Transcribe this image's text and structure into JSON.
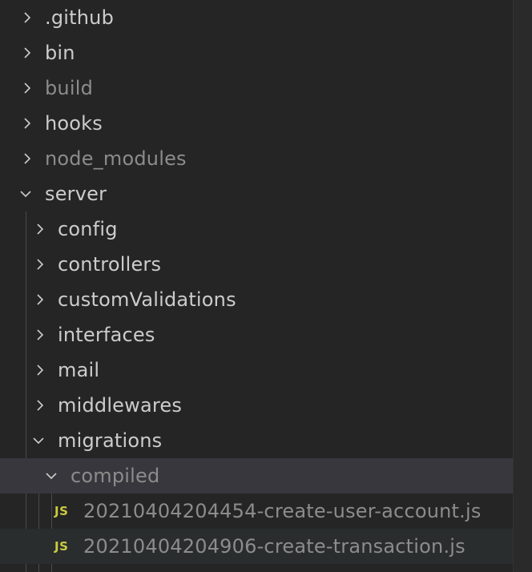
{
  "tree": {
    "root_items": [
      {
        "label": ".github",
        "icon": "chevron-right-icon"
      },
      {
        "label": "bin",
        "icon": "chevron-right-icon"
      },
      {
        "label": "build",
        "icon": "chevron-right-icon"
      },
      {
        "label": "hooks",
        "icon": "chevron-right-icon"
      },
      {
        "label": "node_modules",
        "icon": "chevron-right-icon"
      },
      {
        "label": "server",
        "icon": "chevron-down-icon"
      }
    ],
    "server_items": [
      {
        "label": "config",
        "icon": "chevron-right-icon"
      },
      {
        "label": "controllers",
        "icon": "chevron-right-icon"
      },
      {
        "label": "customValidations",
        "icon": "chevron-right-icon"
      },
      {
        "label": "interfaces",
        "icon": "chevron-right-icon"
      },
      {
        "label": "mail",
        "icon": "chevron-right-icon"
      },
      {
        "label": "middlewares",
        "icon": "chevron-right-icon"
      },
      {
        "label": "migrations",
        "icon": "chevron-down-icon"
      }
    ],
    "migrations_items": [
      {
        "label": "compiled",
        "icon": "chevron-down-icon"
      }
    ],
    "compiled_files": [
      {
        "badge": "JS",
        "label": "20210404204454-create-user-account.js",
        "icon": "js-file-icon"
      },
      {
        "badge": "JS",
        "label": "20210404204906-create-transaction.js",
        "icon": "js-file-icon"
      }
    ]
  },
  "colors": {
    "background": "#252526",
    "text": "#cccccc",
    "ignored_text": "#8c8c8c",
    "selected_row": "#37373d",
    "js_badge": "#cbcb41",
    "indent_guide": "#4b4b4b"
  }
}
